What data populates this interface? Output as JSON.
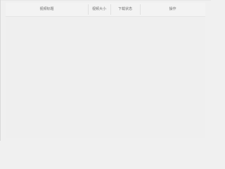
{
  "table": {
    "headers": {
      "title": "视频标题",
      "size": "视频大小",
      "status": "下载状态",
      "action": "操作"
    },
    "rows": []
  }
}
